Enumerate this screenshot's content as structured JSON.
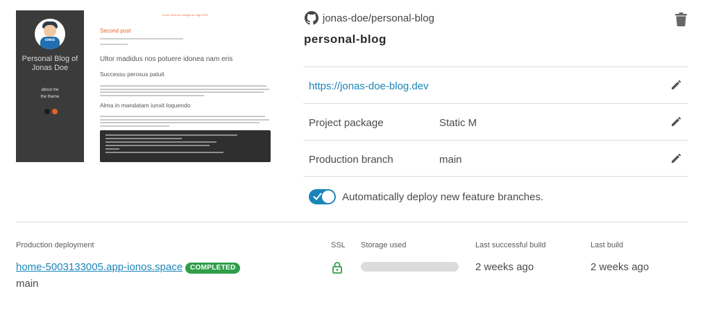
{
  "preview": {
    "sidebar_title": "Personal Blog of Jonas Doe",
    "avatar_tag": "IONOS",
    "nav": [
      "about me",
      "the theme"
    ],
    "topnav": "home   archives   categories   tags   RSS",
    "post_title": "Second post",
    "heading1": "Ultor madidus nos potuere idonea nam eris",
    "heading2": "Successu perosus patuit",
    "heading3": "Alma in mandatam iunxit loquendo"
  },
  "repo": {
    "full_name": "jonas-doe/personal-blog",
    "title": "personal-blog",
    "icon": "github-icon"
  },
  "details": {
    "url": "https://jonas-doe-blog.dev",
    "package_label": "Project package",
    "package_value": "Static M",
    "branch_label": "Production branch",
    "branch_value": "main"
  },
  "auto_deploy": {
    "label": "Automatically deploy new feature branches.",
    "enabled": true
  },
  "deployment": {
    "headers": {
      "production": "Production deployment",
      "ssl": "SSL",
      "storage": "Storage used",
      "last_successful": "Last successful build",
      "last_build": "Last build"
    },
    "domain": "home-5003133005.app-ionos.space",
    "status": "COMPLETED",
    "branch": "main",
    "storage_fraction": 0,
    "last_successful": "2 weeks ago",
    "last_build": "2 weeks ago"
  },
  "colors": {
    "accent": "#1a85b8",
    "success": "#2f9e49",
    "sidebar": "#3b3b3b",
    "preview_accent": "#e3622a"
  }
}
